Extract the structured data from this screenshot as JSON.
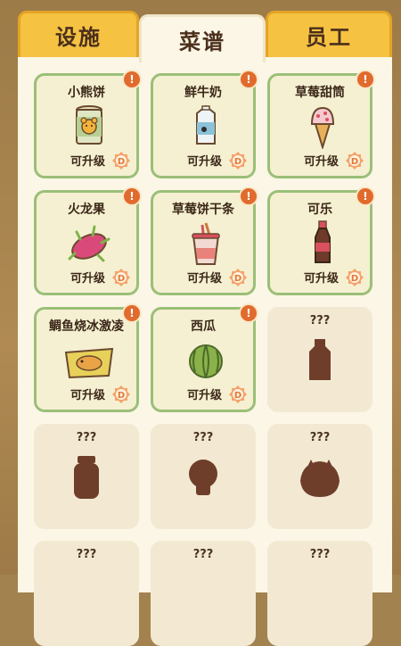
{
  "tabs": [
    {
      "label": "设施"
    },
    {
      "label": "菜谱"
    },
    {
      "label": "员工"
    }
  ],
  "recipes": [
    {
      "name": "小熊饼",
      "status": "可升级",
      "icon": "bear-biscuit-can-icon",
      "locked": false,
      "alert": true
    },
    {
      "name": "鲜牛奶",
      "status": "可升级",
      "icon": "milk-carton-icon",
      "locked": false,
      "alert": true
    },
    {
      "name": "草莓甜筒",
      "status": "可升级",
      "icon": "strawberry-cone-icon",
      "locked": false,
      "alert": true
    },
    {
      "name": "火龙果",
      "status": "可升级",
      "icon": "dragon-fruit-icon",
      "locked": false,
      "alert": true
    },
    {
      "name": "草莓饼干条",
      "status": "可升级",
      "icon": "biscuit-stick-cup-icon",
      "locked": false,
      "alert": true
    },
    {
      "name": "可乐",
      "status": "可升级",
      "icon": "cola-bottle-icon",
      "locked": false,
      "alert": true
    },
    {
      "name": "鲷鱼烧冰激凌",
      "status": "可升级",
      "icon": "taiyaki-icecream-icon",
      "locked": false,
      "alert": true
    },
    {
      "name": "西瓜",
      "status": "可升级",
      "icon": "watermelon-icon",
      "locked": false,
      "alert": true
    },
    {
      "name": "???",
      "icon": "locked-bottle-silhouette-icon",
      "locked": true
    },
    {
      "name": "???",
      "icon": "locked-jar-silhouette-icon",
      "locked": true
    },
    {
      "name": "???",
      "icon": "locked-skull-silhouette-icon",
      "locked": true
    },
    {
      "name": "???",
      "icon": "locked-pie-silhouette-icon",
      "locked": true
    },
    {
      "name": "???",
      "locked": true
    },
    {
      "name": "???",
      "locked": true
    },
    {
      "name": "???",
      "locked": true
    }
  ],
  "alert_mark": "!",
  "coin_letter": "D",
  "colors": {
    "tab_yellow": "#f5c242",
    "panel_cream": "#fbf6e6",
    "card_border_green": "#9bbf78",
    "alert_orange": "#e06b2d",
    "coin_orange": "#f08c4a",
    "silhouette_brown": "#6e3e2a"
  }
}
